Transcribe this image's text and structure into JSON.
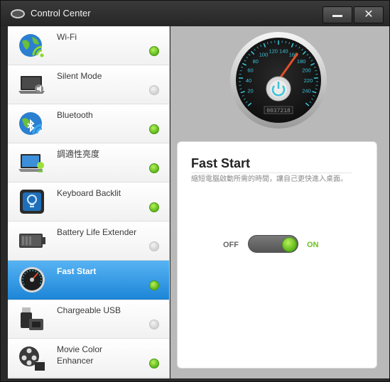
{
  "titlebar": {
    "title": "Control Center",
    "minimize_label": "",
    "close_label": "✕"
  },
  "sidebar": {
    "items": [
      {
        "label": "Wi-Fi",
        "icon": "wifi-globe-icon",
        "enabled": true
      },
      {
        "label": "Silent Mode",
        "icon": "laptop-mute-icon",
        "enabled": false
      },
      {
        "label": "Bluetooth",
        "icon": "bluetooth-globe-icon",
        "enabled": true
      },
      {
        "label": "調適性亮度",
        "icon": "laptop-brightness-icon",
        "enabled": true
      },
      {
        "label": "Keyboard Backlit",
        "icon": "bulb-icon",
        "enabled": true
      },
      {
        "label": "Battery Life Extender",
        "icon": "battery-icon",
        "enabled": false
      },
      {
        "label": "Fast Start",
        "icon": "speedometer-icon",
        "enabled": true,
        "selected": true
      },
      {
        "label": "Chargeable USB",
        "icon": "usb-icon",
        "enabled": false
      },
      {
        "label": "Movie Color Enhancer",
        "icon": "film-reel-icon",
        "enabled": true
      }
    ]
  },
  "gauge": {
    "tick_labels": [
      "20",
      "40",
      "60",
      "80",
      "100",
      "120",
      "140",
      "160",
      "180",
      "200",
      "220",
      "240"
    ],
    "odometer": "0037218"
  },
  "panel": {
    "title": "Fast Start",
    "description": "縮短電腦啟動所需的時間，讓自己更快進入桌面。",
    "toggle_off_label": "OFF",
    "toggle_on_label": "ON",
    "toggle_state": "on"
  },
  "colors": {
    "accent_blue": "#1d86d8",
    "on_green": "#6bc21e"
  }
}
